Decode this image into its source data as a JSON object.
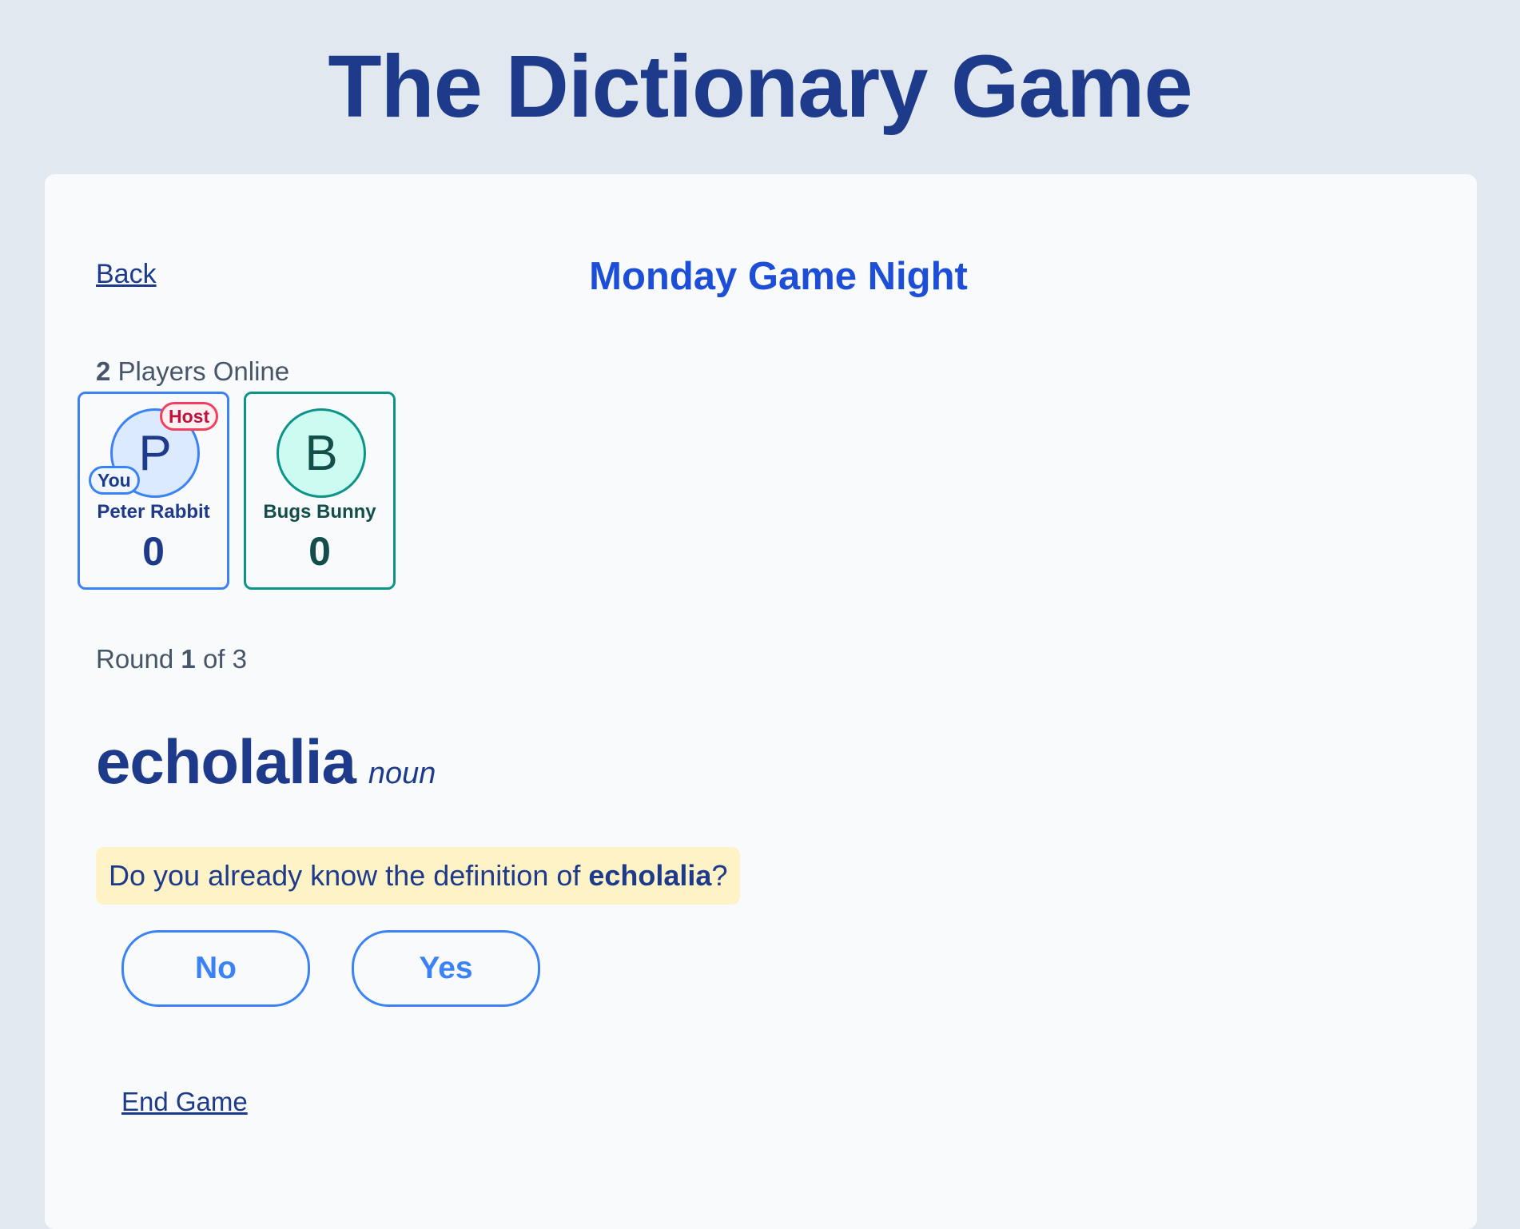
{
  "app_title": "The Dictionary Game",
  "game": {
    "back_label": "Back",
    "name": "Monday Game Night",
    "players_online_count": "2",
    "players_online_label": " Players Online",
    "players": [
      {
        "initial": "P",
        "name": "Peter Rabbit",
        "score": "0",
        "host_badge": "Host",
        "you_badge": "You"
      },
      {
        "initial": "B",
        "name": "Bugs Bunny",
        "score": "0"
      }
    ],
    "round": {
      "prefix": "Round ",
      "current": "1",
      "middle": " of ",
      "total": "3"
    },
    "word": "echolalia",
    "part_of_speech": "noun",
    "question": {
      "prefix": "Do you already know the definition of ",
      "word": "echolalia",
      "suffix": "?"
    },
    "buttons": {
      "no": "No",
      "yes": "Yes"
    },
    "end_game_label": "End Game"
  },
  "colors": {
    "page_background": "#e2e8f0",
    "card_background": "#f8fafc",
    "title": "#1e3a8a",
    "game_name": "#1d4ed8",
    "accent_blue": "#3b82f6",
    "accent_teal": "#0d9488",
    "host_badge": "#be123c",
    "question_highlight": "#fef3c7"
  }
}
